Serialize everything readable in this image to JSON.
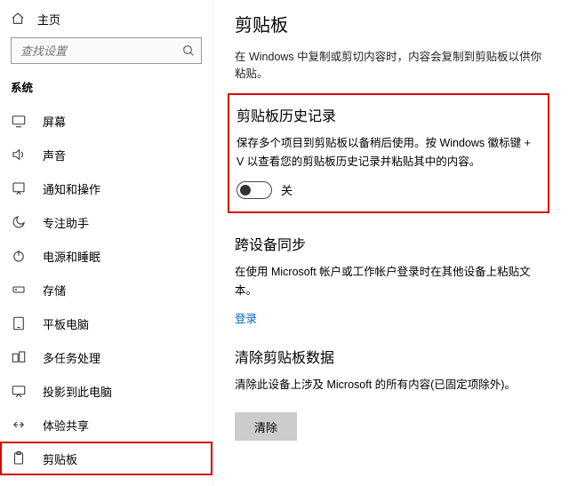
{
  "sidebar": {
    "home_label": "主页",
    "search_placeholder": "查找设置",
    "group_label": "系统",
    "items": [
      {
        "icon": "display-icon",
        "label": "屏幕"
      },
      {
        "icon": "sound-icon",
        "label": "声音"
      },
      {
        "icon": "notify-icon",
        "label": "通知和操作"
      },
      {
        "icon": "focus-icon",
        "label": "专注助手"
      },
      {
        "icon": "power-icon",
        "label": "电源和睡眠"
      },
      {
        "icon": "storage-icon",
        "label": "存储"
      },
      {
        "icon": "tablet-icon",
        "label": "平板电脑"
      },
      {
        "icon": "multitask-icon",
        "label": "多任务处理"
      },
      {
        "icon": "project-icon",
        "label": "投影到此电脑"
      },
      {
        "icon": "shared-icon",
        "label": "体验共享"
      },
      {
        "icon": "clipboard-icon",
        "label": "剪贴板"
      }
    ],
    "selected_index": 10
  },
  "main": {
    "title": "剪贴板",
    "intro": "在 Windows 中复制或剪切内容时，内容会复制到剪贴板以供你粘贴。",
    "history": {
      "heading": "剪贴板历史记录",
      "body": "保存多个项目到剪贴板以备稍后使用。按 Windows 徽标键 + V 以查看您的剪贴板历史记录并粘贴其中的内容。",
      "state_label": "关"
    },
    "sync": {
      "heading": "跨设备同步",
      "body": "在使用 Microsoft 帐户或工作帐户登录时在其他设备上粘贴文本。",
      "link": "登录"
    },
    "clear": {
      "heading": "清除剪贴板数据",
      "body": "清除此设备上涉及 Microsoft 的所有内容(已固定项除外)。",
      "button": "清除"
    }
  }
}
